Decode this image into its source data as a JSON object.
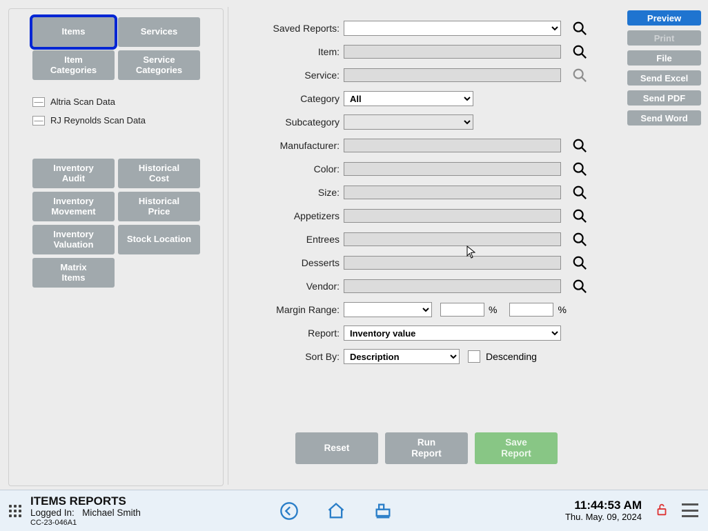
{
  "left": {
    "tabs": {
      "items": "Items",
      "services": "Services",
      "item_categories": "Item\nCategories",
      "service_categories": "Service\nCategories"
    },
    "scan": {
      "altria": "Altria Scan Data",
      "rj": "RJ Reynolds Scan Data"
    },
    "reports": {
      "inventory_audit": "Inventory\nAudit",
      "historical_cost": "Historical\nCost",
      "inventory_movement": "Inventory\nMovement",
      "historical_price": "Historical\nPrice",
      "inventory_valuation": "Inventory\nValuation",
      "stock_location": "Stock Location",
      "matrix_items": "Matrix\nItems"
    }
  },
  "form": {
    "labels": {
      "saved_reports": "Saved Reports:",
      "item": "Item:",
      "service": "Service:",
      "category": "Category",
      "subcategory": "Subcategory",
      "manufacturer": "Manufacturer:",
      "color": "Color:",
      "size": "Size:",
      "appetizers": "Appetizers",
      "entrees": "Entrees",
      "desserts": "Desserts",
      "vendor": "Vendor:",
      "margin_range": "Margin Range:",
      "report": "Report:",
      "sort_by": "Sort By:",
      "descending": "Descending"
    },
    "values": {
      "category": "All",
      "report": "Inventory value",
      "sort_by": "Description"
    },
    "percent": "%"
  },
  "actions": {
    "preview": "Preview",
    "print": "Print",
    "file": "File",
    "send_excel": "Send Excel",
    "send_pdf": "Send PDF",
    "send_word": "Send Word"
  },
  "run": {
    "reset": "Reset",
    "run": "Run\nReport",
    "save": "Save\nReport"
  },
  "status": {
    "title": "ITEMS REPORTS",
    "logged_prefix": "Logged In:",
    "user": "Michael Smith",
    "code": "CC-23-046A1",
    "time": "11:44:53 AM",
    "date": "Thu. May. 09, 2024"
  }
}
